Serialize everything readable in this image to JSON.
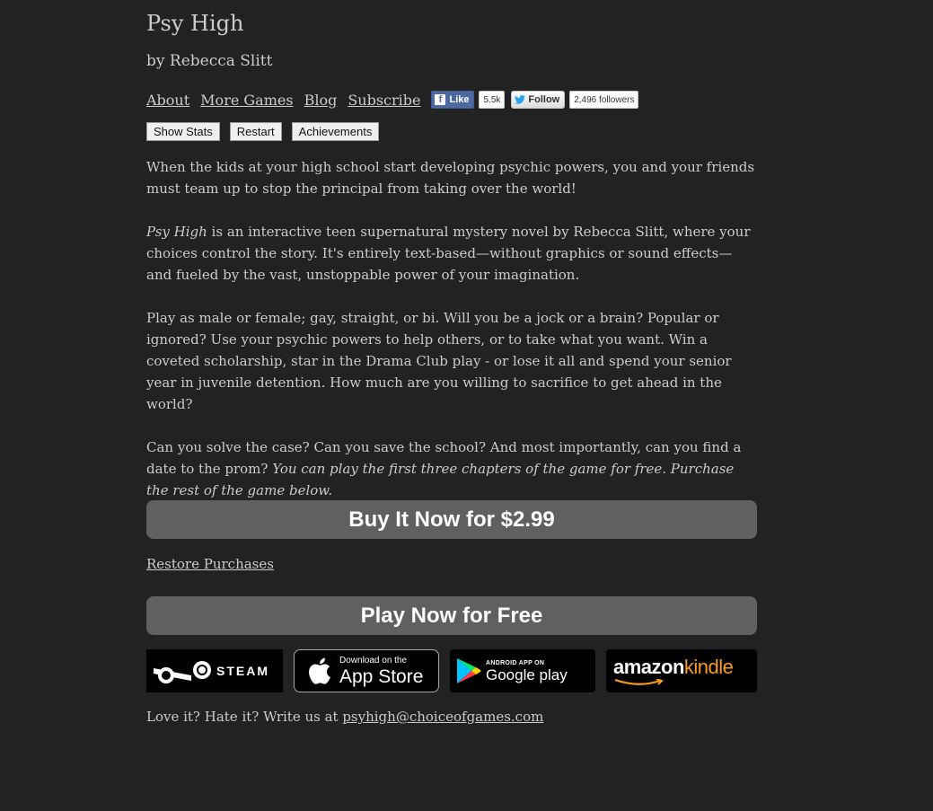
{
  "header": {
    "title": "Psy High",
    "author": "by Rebecca Slitt"
  },
  "nav": {
    "links": [
      "About",
      "More Games",
      "Blog",
      "Subscribe"
    ]
  },
  "social": {
    "fb_like_label": "Like",
    "fb_like_count": "5.5k",
    "tw_follow_label": "Follow",
    "tw_followers": "2,496 followers"
  },
  "toolbar": {
    "show_stats": "Show Stats",
    "restart": "Restart",
    "achievements": "Achievements"
  },
  "story": {
    "p1": "When the kids at your high school start developing psychic powers, you and your friends must team up to stop the principal from taking over the world!",
    "p2_em": "Psy High",
    "p2_rest": " is an interactive teen supernatural mystery novel by Rebecca Slitt, where your choices control the story. It's entirely text-based—without graphics or sound effects—and fueled by the vast, unstoppable power of your imagination.",
    "p3": "Play as male or female; gay, straight, or bi. Will you be a jock or a brain? Popular or ignored? Use your psychic powers to help others, or to take what you want. Win a coveted scholarship, star in the Drama Club play - or lose it all and spend your senior year in juvenile detention. How much are you willing to sacrifice to get ahead in the world?",
    "p4": "Can you solve the case? Can you save the school? And most importantly, can you find a date to the prom? ",
    "p4_em": "You can play the first three chapters of the game for free. Purchase the rest of the game below."
  },
  "purchase": {
    "buy_label": "Buy It Now for $2.99",
    "restore_label": "Restore Purchases",
    "play_free_label": "Play Now for Free"
  },
  "stores": {
    "steam": "STEAM",
    "app_store_top": "Download on the",
    "app_store_bottom": "App Store",
    "google_top": "ANDROID APP ON",
    "google_bottom": "Google play",
    "amazon": "amazon",
    "kindle": "kindle"
  },
  "footer": {
    "text": "Love it? Hate it? Write us at ",
    "email": "psyhigh@choiceofgames.com"
  }
}
